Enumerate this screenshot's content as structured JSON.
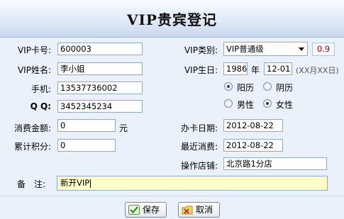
{
  "title": "VIP贵宾登记",
  "form": {
    "card_no_label": "VIP卡号:",
    "card_no": "600003",
    "name_label": "VIP姓名:",
    "name": "李小姐",
    "phone_label": "手机:",
    "phone": "13537736002",
    "qq_label": "Q Q:",
    "qq": "3452345234",
    "amount_label": "消费金额:",
    "amount": "0",
    "amount_unit": "元",
    "points_label": "累计积分:",
    "points": "0",
    "type_label": "VIP类别:",
    "type_value": "VIP普通级",
    "discount": "0.9",
    "birthday_label": "VIP生日:",
    "birth_year": "1986",
    "year_unit": "年",
    "birth_md": "12-01",
    "birth_hint": "(XX月XX日)",
    "calendar_solar": "阳历",
    "calendar_lunar": "阴历",
    "calendar_selected": "阳历",
    "gender_male": "男性",
    "gender_female": "女性",
    "gender_selected": "女性",
    "card_date_label": "办卡日期:",
    "card_date": "2012-08-22",
    "last_purchase_label": "最近消费:",
    "last_purchase": "2012-08-22",
    "store_label": "操作店铺:",
    "store": "北京路1分店",
    "note_label": "备　注:",
    "note": "新开VIP"
  },
  "buttons": {
    "save": "保存",
    "cancel": "取消"
  },
  "colors": {
    "discount_text": "#c00000",
    "note_background": "#ffffc6"
  }
}
